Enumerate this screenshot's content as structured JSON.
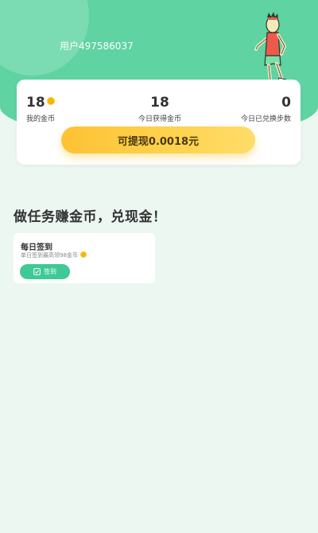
{
  "header": {
    "username": "用户497586037"
  },
  "stats": {
    "my_coins": {
      "value": "18",
      "label": "我的金币"
    },
    "today_earned": {
      "value": "18",
      "label": "今日获得金币"
    },
    "today_steps": {
      "value": "0",
      "label": "今日已兑换步数"
    }
  },
  "withdraw": {
    "label": "可提现0.0018元"
  },
  "section": {
    "title": "做任务赚金币，兑现金！"
  },
  "tasks": [
    {
      "title": "每日签到",
      "desc": "单日签到最高领98金币",
      "button_label": "签到",
      "button_icon": "check-square-icon"
    }
  ],
  "colors": {
    "header_green": "#5fd3a2",
    "coin_gold": "#f7b500",
    "button_gold": "#fec233",
    "checkin_green": "#3ec996"
  }
}
